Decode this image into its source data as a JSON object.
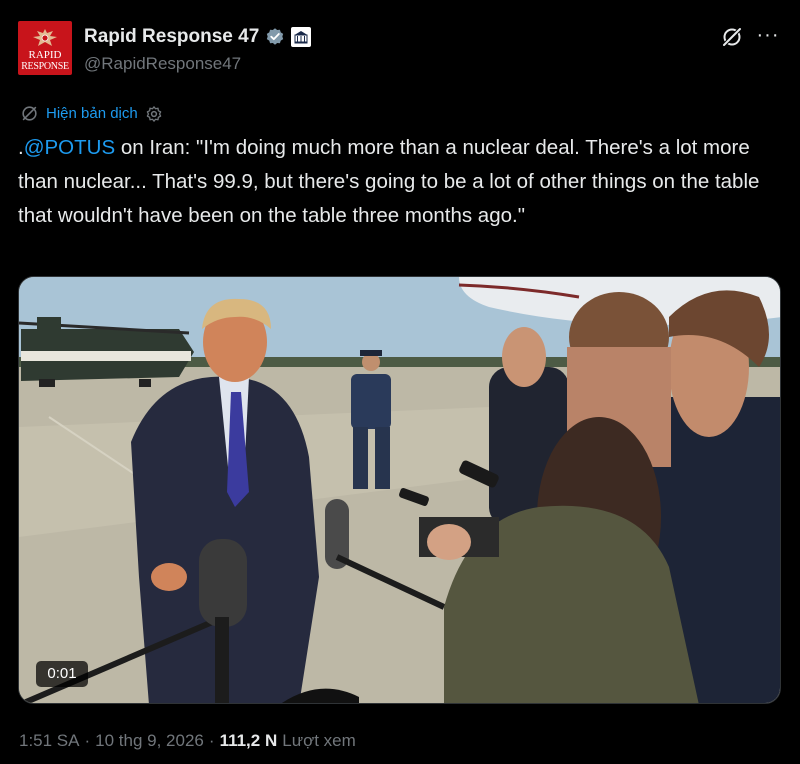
{
  "author": {
    "display_name": "Rapid Response 47",
    "handle": "@RapidResponse47",
    "avatar_text_line1": "RAPID",
    "avatar_text_line2": "RESPONSE",
    "verified_badge": "verified-check-icon",
    "affiliate_badge": "white-house-seal-icon"
  },
  "header_actions": {
    "grok_icon": "grok-icon",
    "more_icon": "more-options-icon",
    "more_label": "···"
  },
  "translate": {
    "label": "Hiện bản dịch",
    "icon": "translate-icon",
    "settings_icon": "gear-icon"
  },
  "tweet": {
    "prefix": ".",
    "mention": "@POTUS",
    "text": " on Iran: \"I'm doing much more than a nuclear deal. There's a lot more than nuclear... That's 99.9, but there's going to be a lot of other things on the table that wouldn't have been on the table three months ago.\""
  },
  "media": {
    "type": "video",
    "duration": "0:01"
  },
  "meta": {
    "time": "1:51 SA",
    "sep1": "·",
    "date": "10 thg 9, 2026",
    "sep2": "·",
    "views_count": "111,2 N",
    "views_label": "Lượt xem"
  },
  "colors": {
    "background": "#000000",
    "text": "#e7e9ea",
    "muted": "#71767b",
    "accent": "#1d9bf0",
    "avatar_red": "#c8141b"
  }
}
